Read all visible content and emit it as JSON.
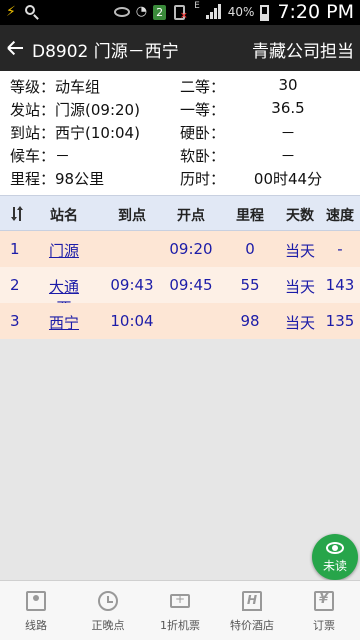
{
  "status_bar": {
    "time": "7:20 PM",
    "battery": "40%",
    "battery_level": 0.4,
    "network_label": "E",
    "badge": "2"
  },
  "header": {
    "title": "D8902 门源－西宁",
    "right_text": "青藏公司担当"
  },
  "info": {
    "rows": [
      {
        "l1": "等级：动车组",
        "l2": "二等：",
        "v2": "30"
      },
      {
        "l1": "发站：门源(09:20)",
        "l2": "一等：",
        "v2": "36.5"
      },
      {
        "l1": "到站：西宁(10:04)",
        "l2": "硬卧：",
        "v2": "－"
      },
      {
        "l1": "候车：－",
        "l2": "软卧：",
        "v2": "－"
      },
      {
        "l1": "里程：98公里",
        "l2": "历时：",
        "v2": "00时44分"
      }
    ]
  },
  "table": {
    "headers": [
      "站名",
      "到点",
      "开点",
      "里程",
      "天数",
      "速度"
    ],
    "rows": [
      {
        "idx": "1",
        "name": "门源",
        "arrive": "",
        "depart": "09:20",
        "km": "0",
        "day": "当天",
        "speed": "-"
      },
      {
        "idx": "2",
        "name": "大通西",
        "arrive": "09:43",
        "depart": "09:45",
        "km": "55",
        "day": "当天",
        "speed": "143"
      },
      {
        "idx": "3",
        "name": "西宁",
        "arrive": "10:04",
        "depart": "",
        "km": "98",
        "day": "当天",
        "speed": "135"
      }
    ],
    "row_colors": [
      "#fde6d5",
      "#fdf0e6",
      "#fde6d5"
    ]
  },
  "fab": {
    "label": "未读"
  },
  "tabs": [
    {
      "label": "线路",
      "icon": "map-icon"
    },
    {
      "label": "正晚点",
      "icon": "clock-icon"
    },
    {
      "label": "1折机票",
      "icon": "ticket-icon"
    },
    {
      "label": "特价酒店",
      "icon": "hotel-icon"
    },
    {
      "label": "订票",
      "icon": "yen-icon"
    }
  ]
}
